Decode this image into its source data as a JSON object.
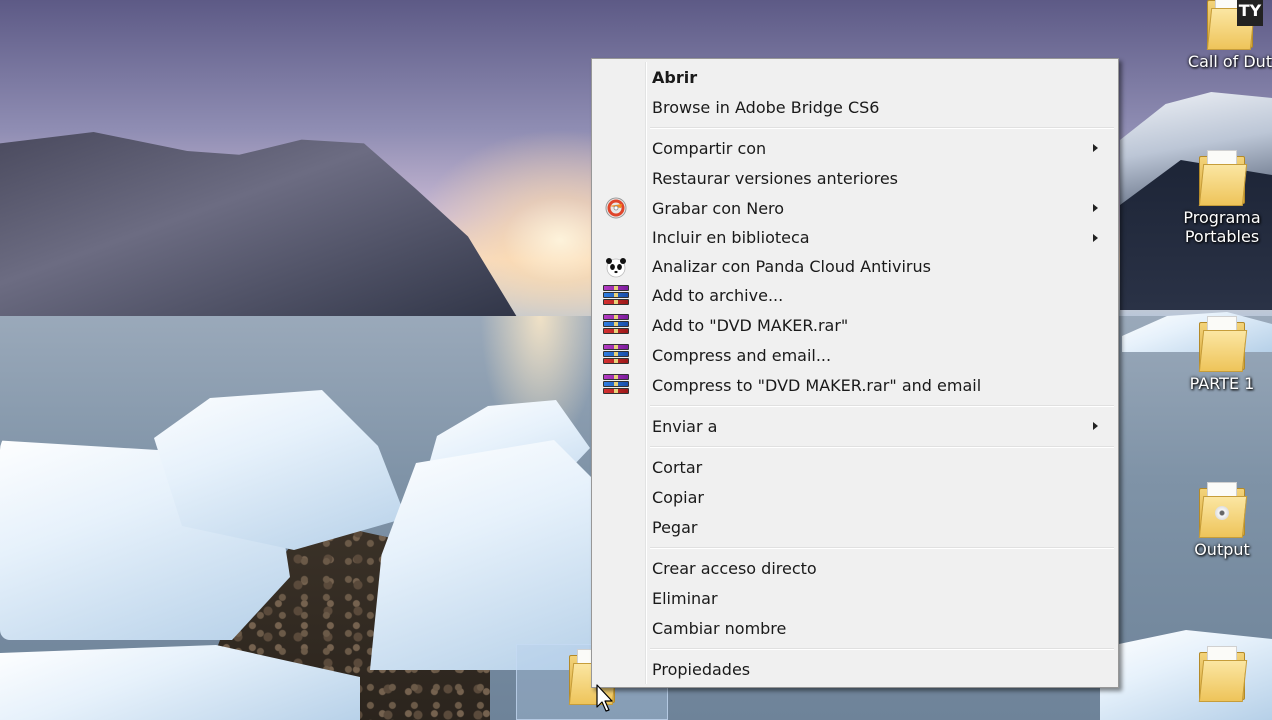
{
  "desktop": {
    "icons": [
      {
        "label": "Call of Dut",
        "badge": "TY"
      },
      {
        "label": "Programa\nPortables"
      },
      {
        "label": "PARTE 1"
      },
      {
        "label": "Output"
      }
    ]
  },
  "context_menu": {
    "items": [
      {
        "label": "Abrir",
        "bold": true
      },
      {
        "label": "Browse in Adobe Bridge CS6"
      },
      {
        "label": "Compartir con",
        "submenu": true
      },
      {
        "label": "Restaurar versiones anteriores"
      },
      {
        "label": "Grabar con Nero",
        "submenu": true,
        "icon": "nero-icon"
      },
      {
        "label": "Incluir en biblioteca",
        "submenu": true
      },
      {
        "label": "Analizar con Panda Cloud Antivirus",
        "icon": "panda-icon"
      },
      {
        "label": "Add to archive...",
        "icon": "winrar-icon"
      },
      {
        "label": "Add to \"DVD MAKER.rar\"",
        "icon": "winrar-icon"
      },
      {
        "label": "Compress and email...",
        "icon": "winrar-icon"
      },
      {
        "label": "Compress to \"DVD MAKER.rar\" and email",
        "icon": "winrar-icon"
      },
      {
        "label": "Enviar a",
        "submenu": true
      },
      {
        "label": "Cortar"
      },
      {
        "label": "Copiar"
      },
      {
        "label": "Pegar"
      },
      {
        "label": "Crear acceso directo"
      },
      {
        "label": "Eliminar"
      },
      {
        "label": "Cambiar nombre"
      },
      {
        "label": "Propiedades"
      }
    ]
  },
  "colors": {
    "menu_bg": "#f0f0f0",
    "menu_border": "#979797",
    "folder_yellow": "#eec45a"
  }
}
